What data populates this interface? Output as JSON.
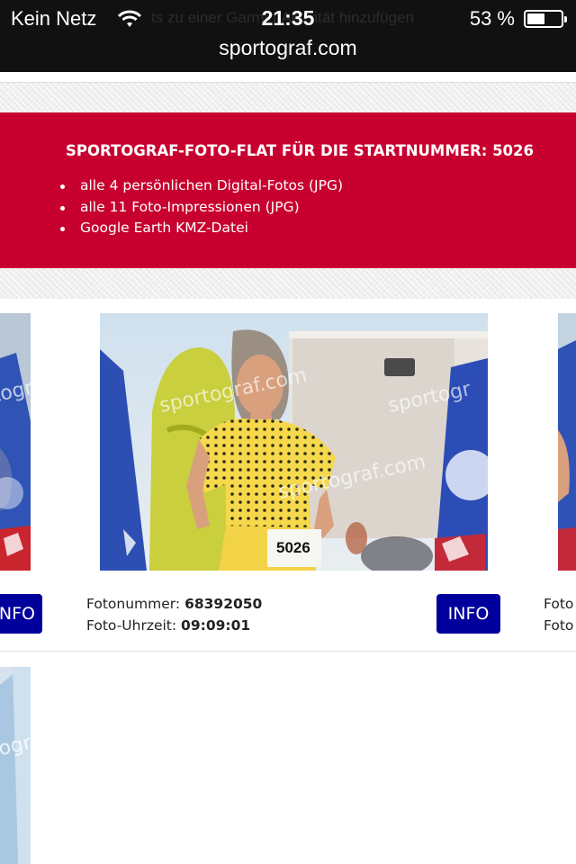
{
  "status_bar": {
    "carrier": "Kein Netz",
    "time": "21:35",
    "battery_percent": "53 %",
    "battery_level": 0.53,
    "obscured_title": "ts zu einer Garmin-Aktivität hinzufügen",
    "url": "sportograf.com"
  },
  "flat_offer": {
    "title": "SPORTOGRAF-FOTO-FLAT FÜR DIE STARTNUMMER: 5026",
    "items": [
      "alle 4 persönlichen Digital-Fotos (JPG)",
      "alle 11 Foto-Impressionen (JPG)",
      "Google Earth KMZ-Datei"
    ],
    "background_color": "#c8002f"
  },
  "photo_card": {
    "watermark": "sportograf.com",
    "watermark_partial": "sportogr",
    "watermark_partial_left": "togr",
    "bib_number": "5026",
    "info_label": "INFO",
    "info_label_partial": "NFO",
    "photo_number_label": "Fotonummer:",
    "photo_number": "68392050",
    "photo_time_label": "Foto-Uhrzeit:",
    "photo_time": "09:09:01",
    "photo_number_label_partial": "Foto",
    "photo_time_label_partial": "Foto",
    "button_color": "#02009c"
  },
  "icons": {
    "wifi": "wifi-icon",
    "battery": "battery-icon",
    "bullet": "bullet-icon"
  }
}
